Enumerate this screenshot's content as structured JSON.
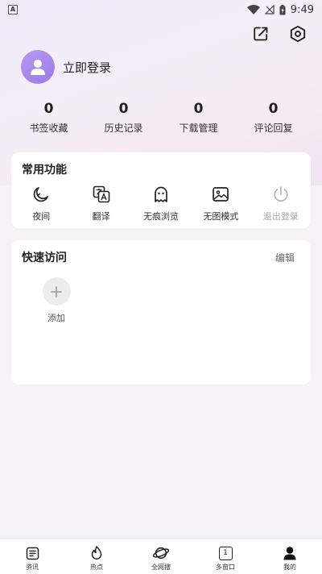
{
  "status": {
    "time": "9:49",
    "left_icon": "A"
  },
  "header": {
    "share_icon": "share-icon",
    "settings_icon": "settings-hexagon-icon"
  },
  "profile": {
    "login_label": "立即登录"
  },
  "stats": [
    {
      "value": "0",
      "label": "书签收藏"
    },
    {
      "value": "0",
      "label": "历史记录"
    },
    {
      "value": "0",
      "label": "下载管理"
    },
    {
      "value": "0",
      "label": "评论回复"
    }
  ],
  "functions": {
    "title": "常用功能",
    "items": [
      {
        "label": "夜间",
        "icon": "moon-icon"
      },
      {
        "label": "翻译",
        "icon": "translate-icon"
      },
      {
        "label": "无痕浏览",
        "icon": "ghost-icon"
      },
      {
        "label": "无图模式",
        "icon": "image-icon"
      },
      {
        "label": "退出登录",
        "icon": "power-icon",
        "disabled": true
      }
    ]
  },
  "quick_access": {
    "title": "快速访问",
    "edit_label": "编辑",
    "add_label": "添加"
  },
  "bottom_nav": [
    {
      "label": "资讯",
      "icon": "news-icon"
    },
    {
      "label": "热点",
      "icon": "flame-icon"
    },
    {
      "label": "全网搜",
      "icon": "planet-icon"
    },
    {
      "label": "多窗口",
      "icon": "window-count-icon",
      "count": "1"
    },
    {
      "label": "我的",
      "icon": "user-icon"
    }
  ]
}
